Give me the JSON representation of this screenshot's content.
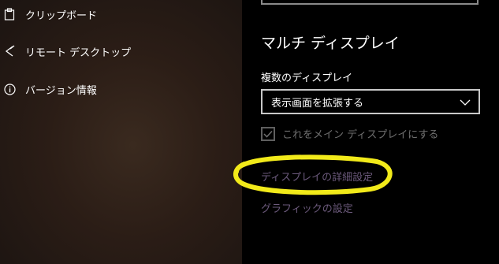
{
  "sidebar": {
    "items": [
      {
        "label": "クリップボード",
        "icon": "clipboard-icon"
      },
      {
        "label": "リモート デスクトップ",
        "icon": "remote-desktop-icon"
      },
      {
        "label": "バージョン情報",
        "icon": "info-icon"
      }
    ]
  },
  "main": {
    "section_title": "マルチ ディスプレイ",
    "multiple_displays_label": "複数のディスプレイ",
    "multiple_displays_value": "表示画面を拡張する",
    "main_display_checkbox": {
      "label": "これをメイン ディスプレイにする",
      "checked": true
    },
    "advanced_display_link": "ディスプレイの詳細設定",
    "graphics_settings_link": "グラフィックの設定"
  },
  "colors": {
    "annotation": "#f2ea1a",
    "link": "#6c5a7c",
    "disabled_text": "#6f6f6f"
  }
}
